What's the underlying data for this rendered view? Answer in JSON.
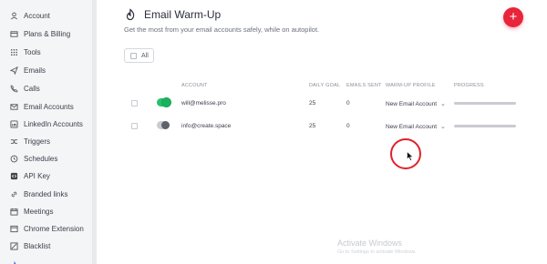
{
  "sidebar": {
    "items": [
      {
        "label": "Account",
        "icon": "user-icon"
      },
      {
        "label": "Plans & Billing",
        "icon": "card-icon"
      },
      {
        "label": "Tools",
        "icon": "grid-icon"
      },
      {
        "label": "Emails",
        "icon": "send-icon"
      },
      {
        "label": "Calls",
        "icon": "phone-icon"
      },
      {
        "label": "Email Accounts",
        "icon": "mail-icon"
      },
      {
        "label": "LinkedIn Accounts",
        "icon": "linkedin-icon"
      },
      {
        "label": "Triggers",
        "icon": "shuffle-icon"
      },
      {
        "label": "Schedules",
        "icon": "clock-icon"
      },
      {
        "label": "API Key",
        "icon": "code-icon"
      },
      {
        "label": "Branded links",
        "icon": "link-icon"
      },
      {
        "label": "Meetings",
        "icon": "calendar-icon"
      },
      {
        "label": "Chrome Extension",
        "icon": "window-icon"
      },
      {
        "label": "Blacklist",
        "icon": "ban-icon"
      }
    ]
  },
  "header": {
    "title": "Email Warm-Up",
    "subtitle": "Get the most from your email accounts safely, while on autopilot.",
    "add_label": "+"
  },
  "filter": {
    "all_label": "All"
  },
  "table": {
    "headers": {
      "account": "ACCOUNT",
      "daily_goal": "DAILY GOAL",
      "emails_sent": "EMAILS SENT",
      "profile": "WARM-UP PROFILE",
      "progress": "PROGRESS"
    },
    "rows": [
      {
        "account": "will@melisse.pro",
        "daily_goal": "25",
        "emails_sent": "0",
        "profile": "New Email Account",
        "enabled": true,
        "progress": 0
      },
      {
        "account": "info@create.space",
        "daily_goal": "25",
        "emails_sent": "0",
        "profile": "New Email Account",
        "enabled": false,
        "progress": 0
      }
    ]
  },
  "watermark": {
    "title": "Activate Windows",
    "subtitle": "Go to Settings to activate Windows."
  },
  "colors": {
    "accent": "#e8253b",
    "toggle_on": "#23c26b",
    "cursor_ring": "#e3202c"
  }
}
